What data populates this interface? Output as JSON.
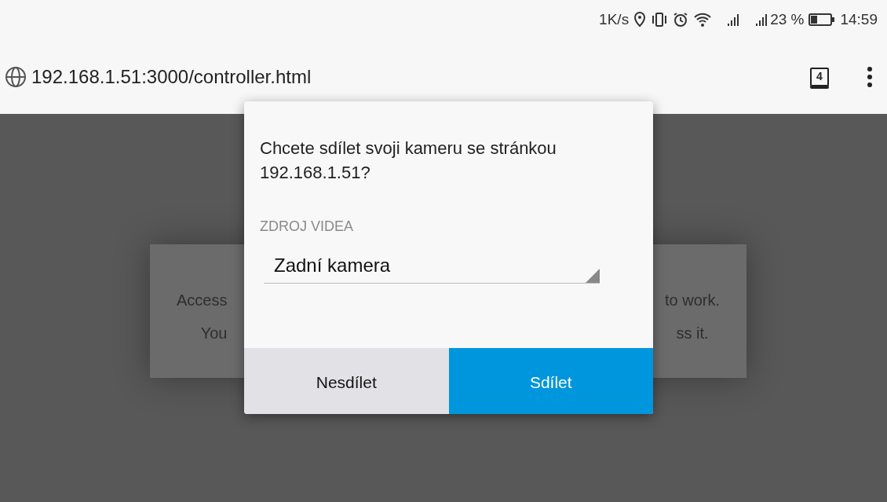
{
  "status_bar": {
    "speed": "1K/s",
    "battery_percent": "23 %",
    "time": "14:59"
  },
  "address_bar": {
    "url": "192.168.1.51:3000/controller.html",
    "tab_count": "4"
  },
  "page_card": {
    "left_lines": [
      "Access",
      "You"
    ],
    "right_lines": [
      "to work.",
      "ss it."
    ]
  },
  "dialog": {
    "message": "Chcete sdílet svoji kameru se stránkou 192.168.1.51?",
    "source_label": "ZDROJ VIDEA",
    "source_value": "Zadní kamera",
    "buttons": [
      {
        "label": "Nesdílet",
        "kind": "secondary"
      },
      {
        "label": "Sdílet",
        "kind": "primary"
      }
    ]
  }
}
